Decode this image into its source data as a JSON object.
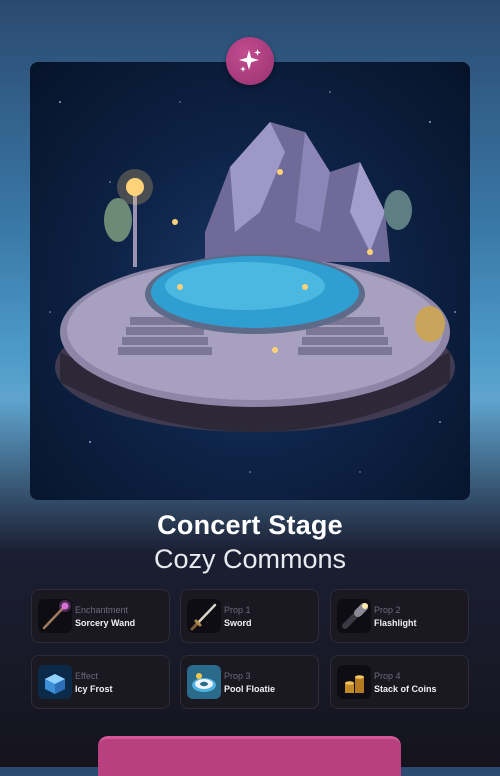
{
  "badge": {
    "icon": "sparkles-icon"
  },
  "artwork": {
    "description_icon": "floating-island-pool-icon"
  },
  "title": "Concert Stage",
  "subtitle": "Cozy Commons",
  "items": [
    {
      "category": "Enchantment",
      "name": "Sorcery Wand",
      "icon": "wand-icon"
    },
    {
      "category": "Prop 1",
      "name": "Sword",
      "icon": "sword-icon"
    },
    {
      "category": "Prop 2",
      "name": "Flashlight",
      "icon": "flashlight-icon"
    },
    {
      "category": "Effect",
      "name": "Icy Frost",
      "icon": "ice-cube-icon"
    },
    {
      "category": "Prop 3",
      "name": "Pool Floatie",
      "icon": "pool-floatie-icon"
    },
    {
      "category": "Prop 4",
      "name": "Stack of Coins",
      "icon": "coins-icon"
    }
  ],
  "colors": {
    "accent": "#b8407f",
    "card_bg": "#1a1922"
  }
}
